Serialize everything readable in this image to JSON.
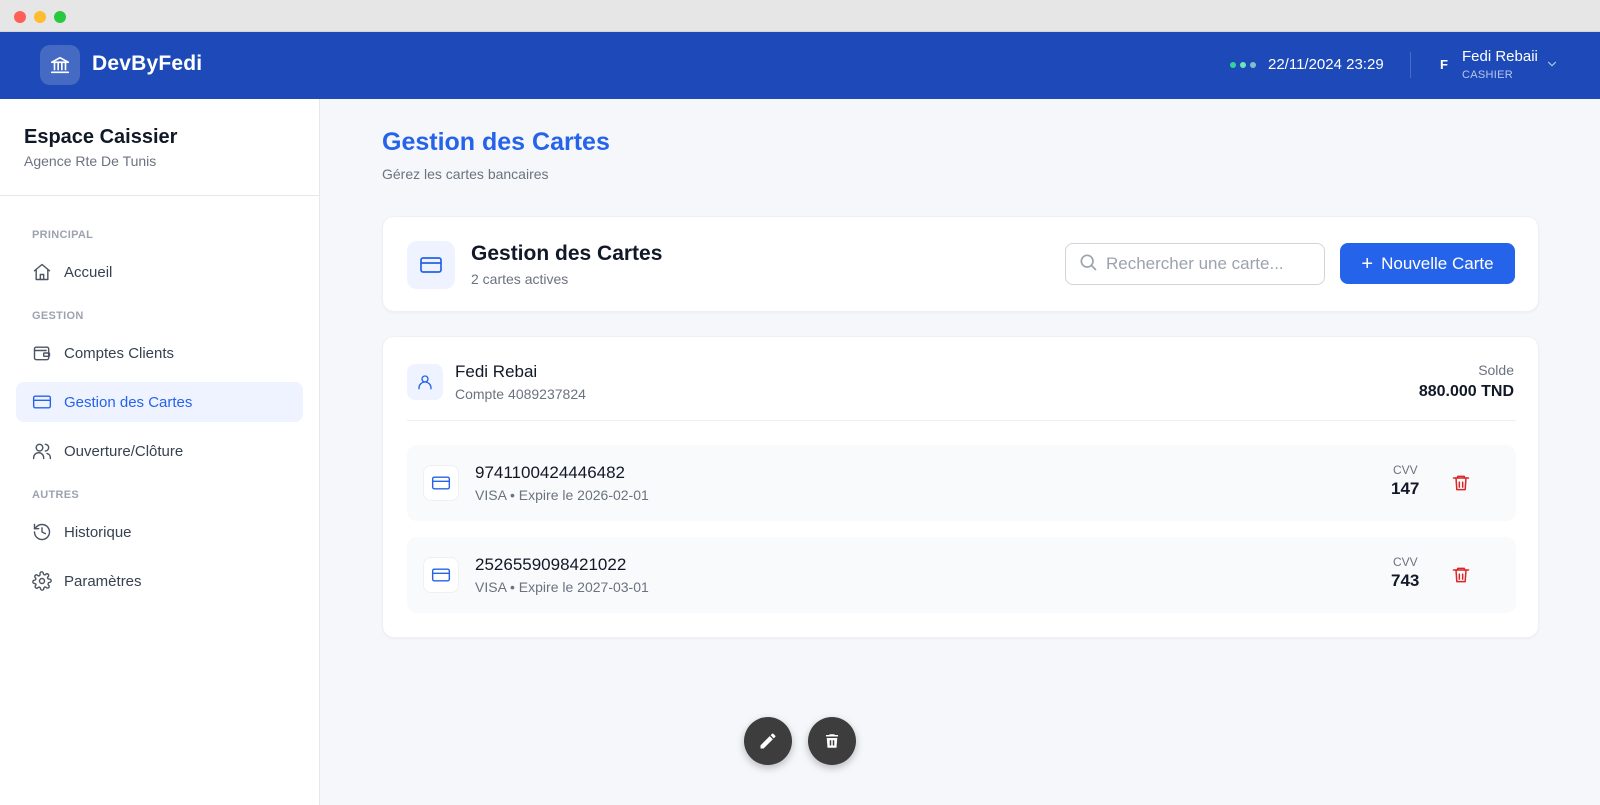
{
  "header": {
    "brand": "DevByFedi",
    "datetime": "22/11/2024 23:29",
    "user_initial": "F",
    "user_name": "Fedi Rebaii",
    "user_role": "CASHIER"
  },
  "sidebar": {
    "title": "Espace Caissier",
    "subtitle": "Agence Rte De Tunis",
    "sections": {
      "principal": "PRINCIPAL",
      "gestion": "GESTION",
      "autres": "AUTRES"
    },
    "items": [
      {
        "label": "Accueil",
        "icon": "home-icon",
        "active": false
      },
      {
        "label": "Comptes Clients",
        "icon": "wallet-icon",
        "active": false
      },
      {
        "label": "Gestion des Cartes",
        "icon": "credit-card-icon",
        "active": true
      },
      {
        "label": "Ouverture/Clôture",
        "icon": "users-icon",
        "active": false
      },
      {
        "label": "Historique",
        "icon": "history-icon",
        "active": false
      },
      {
        "label": "Paramètres",
        "icon": "settings-icon",
        "active": false
      }
    ]
  },
  "page": {
    "title": "Gestion des Cartes",
    "subtitle": "Gérez les cartes bancaires"
  },
  "toolbar": {
    "title": "Gestion des Cartes",
    "count_text": "2 cartes actives",
    "search_placeholder": "Rechercher une carte...",
    "new_card_label": "Nouvelle Carte"
  },
  "client": {
    "name": "Fedi Rebai",
    "account_label": "Compte",
    "account_number": "4089237824",
    "balance_label": "Solde",
    "balance_value": "880.000 TND"
  },
  "cards": [
    {
      "number": "9741100424446482",
      "meta": "VISA • Expire le 2026-02-01",
      "cvv_label": "CVV",
      "cvv": "147"
    },
    {
      "number": "2526559098421022",
      "meta": "VISA • Expire le 2027-03-01",
      "cvv_label": "CVV",
      "cvv": "743"
    }
  ],
  "colors": {
    "header_bg": "#1d4ab8",
    "accent": "#2563eb",
    "danger": "#dc2626"
  }
}
